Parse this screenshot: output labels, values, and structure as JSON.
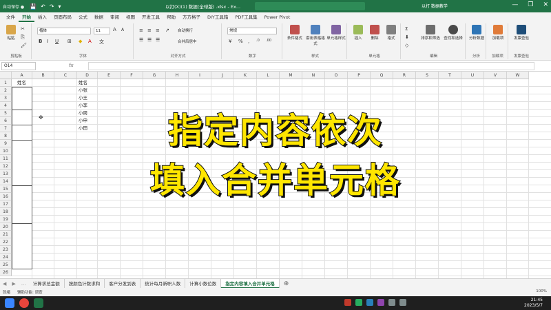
{
  "titlebar": {
    "autosave": "自动保存 ●",
    "quick_access": [
      "💾",
      "↶",
      "↷",
      "▾"
    ],
    "title": "以打(X)(1) 数据(全球版) .xlsx - Ex...",
    "user": "以打 数据教学",
    "win_controls": [
      "—",
      "❐",
      "✕"
    ]
  },
  "tabs": [
    "文件",
    "开始",
    "插入",
    "页面布局",
    "公式",
    "数据",
    "审阅",
    "视图",
    "开发工具",
    "帮助",
    "方方格子",
    "DIY工具箱",
    "PDF工具集",
    "Power Pivot"
  ],
  "active_tab": "开始",
  "ribbon": {
    "groups": [
      "剪贴板",
      "字体",
      "对齐方式",
      "数字",
      "样式",
      "单元格",
      "编辑",
      "分析",
      "加载项",
      "发票查验"
    ],
    "paste_label": "粘贴",
    "font_name": "楷体",
    "font_size": "11",
    "wrap_text": "自动换行",
    "merge_center": "合并后居中",
    "number_format": "常规",
    "cond_format": "条件格式",
    "table_format": "套用表格格式",
    "cell_styles": "单元格样式",
    "insert": "插入",
    "delete": "删除",
    "format": "格式",
    "sort_filter": "排序和筛选",
    "find_select": "查找和选择",
    "analyze": "分析数据",
    "addins": "加载项",
    "invoice": "发票查验"
  },
  "formula_bar": {
    "name_box": "O14",
    "fx": "fx"
  },
  "columns": [
    "A",
    "B",
    "C",
    "D",
    "E",
    "F",
    "G",
    "H",
    "I",
    "J",
    "K",
    "L",
    "M",
    "N",
    "O",
    "P",
    "Q",
    "R",
    "S",
    "T",
    "U",
    "V",
    "W"
  ],
  "rows": [
    "1",
    "2",
    "3",
    "4",
    "5",
    "6",
    "7",
    "8",
    "9",
    "10",
    "11",
    "12",
    "13",
    "14",
    "15",
    "16",
    "17",
    "18",
    "19",
    "20",
    "21",
    "22",
    "23",
    "24",
    "25",
    "26"
  ],
  "cells": {
    "A1": "姓名",
    "D1": "姓名",
    "D2": "小张",
    "D3": "小王",
    "D4": "小李",
    "D5": "小周",
    "D6": "小申",
    "D7": "小田"
  },
  "overlay": {
    "line1": "指定内容依次",
    "line2": "填入合并单元格"
  },
  "sheet_tabs": [
    "计算求总金额",
    "按颜色计数求和",
    "客户分发到表",
    "统计每月新职人数",
    "计算小数位数",
    "指定内容填入合并单元格"
  ],
  "active_sheet": "指定内容填入合并单元格",
  "statusbar": {
    "mode": "就绪",
    "accessibility": "辅助功能: 调查",
    "zoom": "100%"
  },
  "taskbar": {
    "time": "21:45",
    "date": "2023/5/7"
  },
  "colors": {
    "excel_green": "#217346",
    "overlay_yellow": "#ffe600"
  }
}
